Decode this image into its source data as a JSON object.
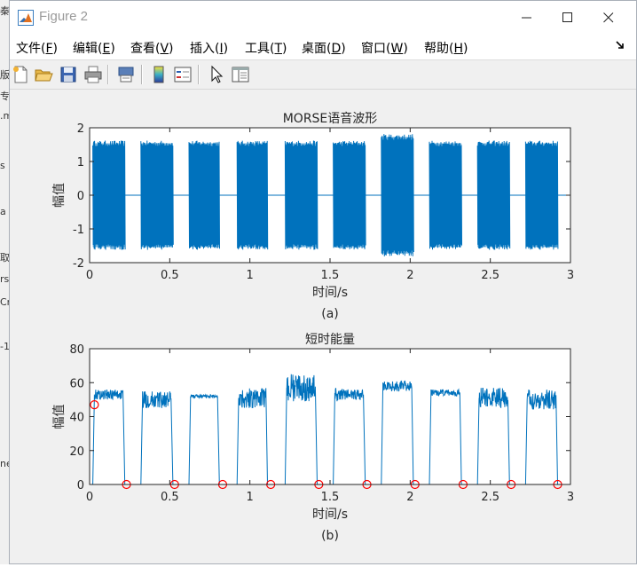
{
  "window": {
    "title": "Figure 2"
  },
  "menu": [
    {
      "label": "文件",
      "key": "F"
    },
    {
      "label": "编辑",
      "key": "E"
    },
    {
      "label": "查看",
      "key": "V"
    },
    {
      "label": "插入",
      "key": "I"
    },
    {
      "label": "工具",
      "key": "T"
    },
    {
      "label": "桌面",
      "key": "D"
    },
    {
      "label": "窗口",
      "key": "W"
    },
    {
      "label": "帮助",
      "key": "H"
    }
  ],
  "left_fragments": [
    "秦",
    "版",
    "专",
    ".m",
    "s",
    "a",
    "取",
    "rs",
    "Cr",
    "-1",
    "ne"
  ],
  "colors": {
    "line": "#0072bd",
    "marker": "#ff0000",
    "axes_bg": "#ffffff",
    "figure_bg": "#f0f0f0"
  },
  "chart_data": [
    {
      "type": "line",
      "title": "MORSE语音波形",
      "xlabel": "时间/s",
      "ylabel": "幅值",
      "caption": "(a)",
      "xlim": [
        0,
        3
      ],
      "ylim": [
        -2,
        2
      ],
      "xticks": [
        0,
        0.5,
        1,
        1.5,
        2,
        2.5,
        3
      ],
      "xticklabels": [
        "0",
        "0.5",
        "1",
        "1.5",
        "2",
        "2.5",
        "3"
      ],
      "yticks": [
        -2,
        -1,
        0,
        1,
        2
      ],
      "yticklabels": [
        "-2",
        "-1",
        "0",
        "1",
        "2"
      ],
      "grid": false,
      "bursts": [
        {
          "start": 0.02,
          "end": 0.22,
          "amplitude": 1.62
        },
        {
          "start": 0.32,
          "end": 0.52,
          "amplitude": 1.62
        },
        {
          "start": 0.62,
          "end": 0.81,
          "amplitude": 1.62
        },
        {
          "start": 0.92,
          "end": 1.11,
          "amplitude": 1.62
        },
        {
          "start": 1.22,
          "end": 1.42,
          "amplitude": 1.62
        },
        {
          "start": 1.52,
          "end": 1.72,
          "amplitude": 1.62
        },
        {
          "start": 1.82,
          "end": 2.02,
          "amplitude": 1.82
        },
        {
          "start": 2.12,
          "end": 2.32,
          "amplitude": 1.62
        },
        {
          "start": 2.42,
          "end": 2.62,
          "amplitude": 1.62
        },
        {
          "start": 2.72,
          "end": 2.92,
          "amplitude": 1.62
        }
      ]
    },
    {
      "type": "line",
      "title": "短时能量",
      "xlabel": "时间/s",
      "ylabel": "幅值",
      "caption": "(b)",
      "xlim": [
        0,
        3
      ],
      "ylim": [
        0,
        80
      ],
      "xticks": [
        0,
        0.5,
        1,
        1.5,
        2,
        2.5,
        3
      ],
      "xticklabels": [
        "0",
        "0.5",
        "1",
        "1.5",
        "2",
        "2.5",
        "3"
      ],
      "yticks": [
        0,
        20,
        40,
        60,
        80
      ],
      "yticklabels": [
        "0",
        "20",
        "40",
        "60",
        "80"
      ],
      "grid": false,
      "plateaus": [
        {
          "start": 0.02,
          "end": 0.22,
          "level": 53,
          "ripple": 3
        },
        {
          "start": 0.32,
          "end": 0.52,
          "level": 50,
          "ripple": 5
        },
        {
          "start": 0.62,
          "end": 0.81,
          "level": 52,
          "ripple": 1
        },
        {
          "start": 0.92,
          "end": 1.11,
          "level": 51,
          "ripple": 6
        },
        {
          "start": 1.22,
          "end": 1.42,
          "level": 57,
          "ripple": 8
        },
        {
          "start": 1.52,
          "end": 1.72,
          "level": 53,
          "ripple": 4
        },
        {
          "start": 1.82,
          "end": 2.02,
          "level": 58,
          "ripple": 3
        },
        {
          "start": 2.12,
          "end": 2.32,
          "level": 54,
          "ripple": 2
        },
        {
          "start": 2.42,
          "end": 2.62,
          "level": 51,
          "ripple": 6
        },
        {
          "start": 2.72,
          "end": 2.92,
          "level": 50,
          "ripple": 6
        }
      ],
      "markers": {
        "x": [
          0.03,
          0.23,
          0.53,
          0.83,
          1.13,
          1.43,
          1.73,
          2.03,
          2.33,
          2.63,
          2.92
        ],
        "y": [
          47,
          0,
          0,
          0,
          0,
          0,
          0,
          0,
          0,
          0,
          0
        ]
      }
    }
  ]
}
